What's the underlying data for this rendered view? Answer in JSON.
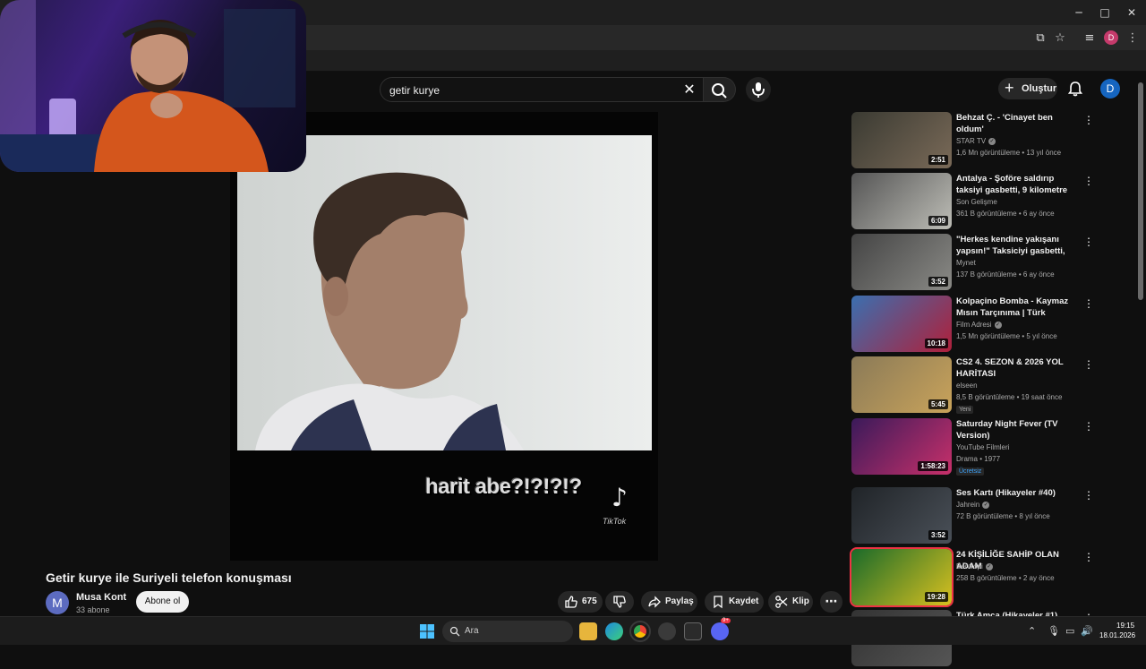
{
  "browser": {
    "window_controls": {
      "minimize": "─",
      "maximize": "□",
      "close": "✕"
    },
    "profile_initial": "D"
  },
  "header": {
    "search": {
      "value": "getir kurye",
      "placeholder": "Ara"
    },
    "create_label": "Oluştur",
    "avatar_initial": "D"
  },
  "player": {
    "caption": "harit abe?!?!?!?",
    "watermark": "TikTok"
  },
  "video": {
    "title": "Getir kurye ile Suriyeli telefon konuşması",
    "channel": {
      "initial": "M",
      "name": "Musa Kont",
      "subscribers": "33 abone"
    },
    "subscribe_label": "Abone ol",
    "likes": "675",
    "share_label": "Paylaş",
    "save_label": "Kaydet",
    "clip_label": "Klip"
  },
  "recommendations": [
    {
      "title": "Behzat Ç. - 'Cinayet ben oldum'",
      "channel": "STAR TV",
      "verified": true,
      "meta": "1,6 Mn görüntüleme • 13 yıl önce",
      "duration": "2:51",
      "badge": "",
      "thumb_colors": [
        "#3a3a32",
        "#7a6a58"
      ]
    },
    {
      "title": "Antalya - Şoföre saldırıp taksiyi gasbetti, 9 kilometre sonra ka...",
      "channel": "Son Gelişme",
      "verified": false,
      "meta": "361 B görüntüleme • 6 ay önce",
      "duration": "6:09",
      "badge": "",
      "thumb_colors": [
        "#555",
        "#bdbdb6"
      ]
    },
    {
      "title": "\"Herkes kendine yakışanı yapsın!\" Taksiciyi gasbetti, ara...",
      "channel": "Mynet",
      "verified": false,
      "meta": "137 B görüntüleme • 6 ay önce",
      "duration": "3:52",
      "badge": "",
      "thumb_colors": [
        "#444",
        "#8a8a86"
      ]
    },
    {
      "title": "Kolpaçino Bomba - Kaymaz Mısın Tarçınıma | Türk Komedi...",
      "channel": "Film Adresi",
      "verified": true,
      "meta": "1,5 Mn görüntüleme • 5 yıl önce",
      "duration": "10:18",
      "badge": "",
      "thumb_colors": [
        "#3a6fb0",
        "#b0203a"
      ]
    },
    {
      "title": "CS2 4. SEZON & 2026 YOL HARİTASI",
      "channel": "elseen",
      "verified": false,
      "meta": "8,5 B görüntüleme • 19 saat önce",
      "duration": "5:45",
      "badge": "Yeni",
      "thumb_colors": [
        "#8a7a58",
        "#c9a35a"
      ]
    },
    {
      "title": "Saturday Night Fever (TV Version)",
      "channel": "YouTube Filmleri",
      "verified": false,
      "meta": "Drama • 1977",
      "duration": "1:58:23",
      "badge": "Ücretsiz",
      "thumb_colors": [
        "#3a1a5a",
        "#c8306a"
      ]
    },
    {
      "title": "Ses Kartı (Hikayeler #40)",
      "channel": "Jahrein",
      "verified": true,
      "meta": "72 B görüntüleme • 8 yıl önce",
      "duration": "3:52",
      "badge": "",
      "thumb_colors": [
        "#202428",
        "#4a5058"
      ]
    },
    {
      "title": "24 KİŞİLİĞE SAHİP OLAN ADAM",
      "channel": "Bentropi",
      "verified": true,
      "meta": "258 B görüntüleme • 2 ay önce",
      "duration": "19:28",
      "badge": "",
      "thumb_colors": [
        "#1a6a2a",
        "#d8c020"
      ]
    },
    {
      "title": "Türk Amca (Hikayeler #1)",
      "channel": "",
      "verified": false,
      "meta": "",
      "duration": "",
      "badge": "",
      "thumb_colors": [
        "#333",
        "#555"
      ]
    }
  ],
  "taskbar": {
    "search_label": "Ara",
    "time": "19:15",
    "date": "18.01.2026",
    "discord_badge": "9+"
  },
  "colors": {
    "accent": "#3ea6ff",
    "background": "#0f0f0f",
    "surface": "#272727"
  }
}
